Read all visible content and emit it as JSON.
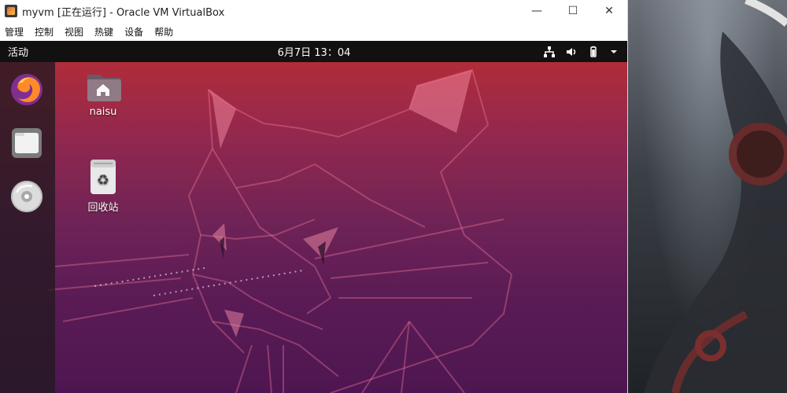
{
  "window": {
    "title": "myvm [正在运行] - Oracle VM VirtualBox",
    "controls": {
      "minimize": "—",
      "maximize": "☐",
      "close": "✕"
    }
  },
  "menu": {
    "items": [
      {
        "label": "管理"
      },
      {
        "label": "控制"
      },
      {
        "label": "视图"
      },
      {
        "label": "热键"
      },
      {
        "label": "设备"
      },
      {
        "label": "帮助"
      }
    ]
  },
  "guest": {
    "topbar": {
      "activities": "活动",
      "clock": "6月7日 13：04"
    },
    "dock": {
      "items": [
        {
          "icon": "firefox-icon"
        },
        {
          "icon": "files-icon"
        },
        {
          "icon": "disc-icon"
        }
      ]
    },
    "desktop": {
      "icons": [
        {
          "icon": "home-folder-icon",
          "label": "naisu"
        },
        {
          "icon": "trash-icon",
          "label": "回收站"
        }
      ]
    }
  },
  "colors": {
    "ubuntu_topbar": "#111111",
    "wallpaper_top": "#b02c3a",
    "wallpaper_bottom": "#4e1651",
    "vbox_chrome": "#ffffff"
  }
}
